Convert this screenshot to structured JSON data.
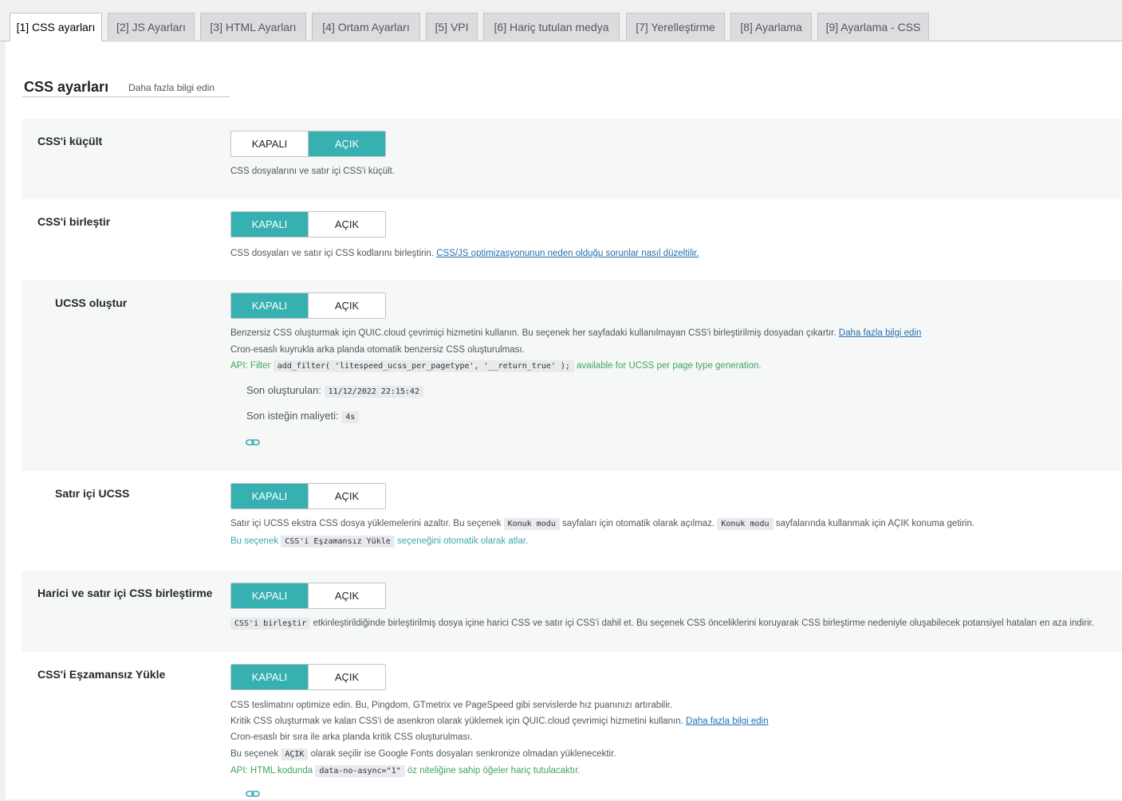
{
  "tabs": [
    {
      "label": "[1] CSS ayarları",
      "active": true
    },
    {
      "label": "[2] JS Ayarları",
      "active": false
    },
    {
      "label": "[3] HTML Ayarları",
      "active": false
    },
    {
      "label": "[4] Ortam Ayarları",
      "active": false
    },
    {
      "label": "[5] VPI",
      "active": false
    },
    {
      "label": "[6] Hariç tutulan medya",
      "active": false
    },
    {
      "label": "[7] Yerelleştirme",
      "active": false
    },
    {
      "label": "[8] Ayarlama",
      "active": false
    },
    {
      "label": "[9] Ayarlama - CSS",
      "active": false
    }
  ],
  "section": {
    "title": "CSS ayarları",
    "learn_more": "Daha fazla bilgi edin"
  },
  "toggle_labels": {
    "off": "KAPALI",
    "on": "AÇIK"
  },
  "settings": {
    "css_minify": {
      "label": "CSS'i küçült",
      "value": "on",
      "desc": "CSS dosyalarını ve satır içi CSS'i küçült."
    },
    "css_combine": {
      "label": "CSS'i birleştir",
      "value": "off",
      "desc": "CSS dosyaları ve satır içi CSS kodlarını birleştirin.",
      "link": "CSS/JS optimizasyonunun neden olduğu sorunlar nasıl düzeltilir."
    },
    "ucss": {
      "label": "UCSS oluştur",
      "value": "off",
      "desc1": "Benzersiz CSS oluşturmak için QUIC.cloud çevrimiçi hizmetini kullanın. Bu seçenek her sayfadaki kullanılmayan CSS'i birleştirilmiş dosyadan çıkartır.",
      "desc1_link": "Daha fazla bilgi edin",
      "desc2": "Cron-esaslı kuyrukla arka planda otomatik benzersiz CSS oluşturulması.",
      "api_prefix": "API: Filter",
      "api_code": "add_filter( 'litespeed_ucss_per_pagetype', '__return_true' );",
      "api_suffix": "available for UCSS per page type generation.",
      "last_generated_label": "Son oluşturulan:",
      "last_generated_value": "11/12/2022 22:15:42",
      "last_cost_label": "Son isteğin maliyeti:",
      "last_cost_value": "4s",
      "chain_icon": "link-icon"
    },
    "ucss_inline": {
      "label": "Satır içi UCSS",
      "value": "off",
      "desc_a": "Satır içi UCSS ekstra CSS dosya yüklemelerini azaltır. Bu seçenek",
      "code1": "Konuk modu",
      "desc_b": "sayfaları için otomatik olarak açılmaz.",
      "code2": "Konuk modu",
      "desc_c": "sayfalarında kullanmak için AÇIK konuma getirin.",
      "note_a": "Bu seçenek",
      "note_code": "CSS'i Eşzamansız Yükle",
      "note_b": "seçeneğini otomatik olarak atlar."
    },
    "css_combine_external_inline": {
      "label": "Harici ve satır içi CSS birleştirme",
      "value": "off",
      "code": "CSS'i birleştir",
      "desc": "etkinleştirildiğinde birleştirilmiş dosya içine harici CSS ve satır içi CSS'i dahil et. Bu seçenek CSS önceliklerini koruyarak CSS birleştirme nedeniyle oluşabilecek potansiyel hataları en aza indirir."
    },
    "css_async": {
      "label": "CSS'i Eşzamansız Yükle",
      "value": "off",
      "desc1": "CSS teslimatını optimize edin. Bu, Pingdom, GTmetrix ve PageSpeed gibi servislerde hız puanınızı artırabilir.",
      "desc2": "Kritik CSS oluşturmak ve kalan CSS'i de asenkron olarak yüklemek için QUIC.cloud çevrimiçi hizmetini kullanın.",
      "desc2_link": "Daha fazla bilgi edin",
      "desc3": "Cron-esaslı bir sıra ile arka planda kritik CSS oluşturulması.",
      "desc4_a": "Bu seçenek",
      "desc4_code": "AÇIK",
      "desc4_b": "olarak seçilir ise Google Fonts dosyaları senkronize olmadan yüklenecektir.",
      "api_prefix": "API: HTML kodunda",
      "api_code": "data-no-async=\"1\"",
      "api_suffix": "öz niteliğine sahip öğeler hariç tutulacaktır.",
      "chain_icon": "link-icon"
    }
  },
  "colors": {
    "accent": "#36b0b0",
    "link": "#2271b1",
    "api_green": "#3fa560",
    "note_teal": "#3aa9b5"
  }
}
